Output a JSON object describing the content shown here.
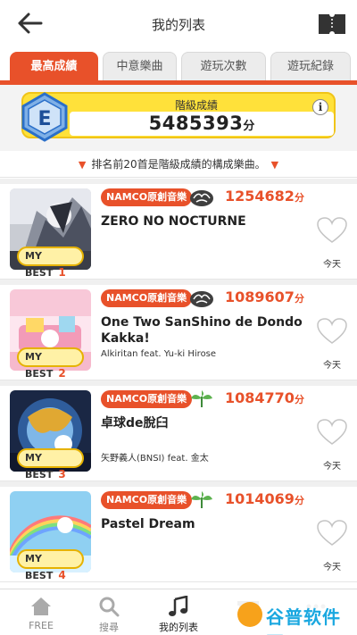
{
  "header": {
    "title": "我的列表",
    "back_icon": "back-arrow-icon",
    "ticket_icon": "ticket-icon"
  },
  "tabs": [
    {
      "label": "最高成績",
      "active": true
    },
    {
      "label": "中意樂曲",
      "active": false
    },
    {
      "label": "遊玩次數",
      "active": false
    },
    {
      "label": "遊玩紀錄",
      "active": false
    }
  ],
  "rank": {
    "label": "階級成績",
    "grade": "E",
    "value": "5485393",
    "unit": "分",
    "info": "i"
  },
  "notice": {
    "text": "排名前20首是階級成績的構成樂曲。"
  },
  "songs": [
    {
      "mybest_label": "MY BEST",
      "rank": "1",
      "category": "NAMCO原創音樂",
      "difficulty": "hard",
      "score": "1254682",
      "unit": "分",
      "title": "ZERO NO NOCTURNE",
      "artist": "",
      "date": "今天"
    },
    {
      "mybest_label": "MY BEST",
      "rank": "2",
      "category": "NAMCO原創音樂",
      "difficulty": "hard",
      "score": "1089607",
      "unit": "分",
      "title": "One Two SanShino de Dondo Kakka!",
      "artist": "Alkiritan feat. Yu-ki Hirose",
      "date": "今天"
    },
    {
      "mybest_label": "MY BEST",
      "rank": "3",
      "category": "NAMCO原創音樂",
      "difficulty": "normal",
      "score": "1084770",
      "unit": "分",
      "title": "卓球de脫臼",
      "artist": "矢野義人(BNSI) feat. 金太",
      "date": "今天"
    },
    {
      "mybest_label": "MY BEST",
      "rank": "4",
      "category": "NAMCO原創音樂",
      "difficulty": "normal",
      "score": "1014069",
      "unit": "分",
      "title": "Pastel Dream",
      "artist": "",
      "date": "今天"
    }
  ],
  "nav": [
    {
      "label": "FREE",
      "icon": "home-icon",
      "active": false
    },
    {
      "label": "搜尋",
      "icon": "search-icon",
      "active": false
    },
    {
      "label": "我的列表",
      "icon": "music-note-icon",
      "active": true
    },
    {
      "label": "",
      "icon": "gift-icon",
      "active": false
    },
    {
      "label": "",
      "icon": "more-icon",
      "active": false
    }
  ],
  "watermark": {
    "text": "谷普软件园"
  },
  "colors": {
    "accent": "#e8512a",
    "rank_yellow": "#ffe13a",
    "badge_blue": "#2a6fc9"
  }
}
